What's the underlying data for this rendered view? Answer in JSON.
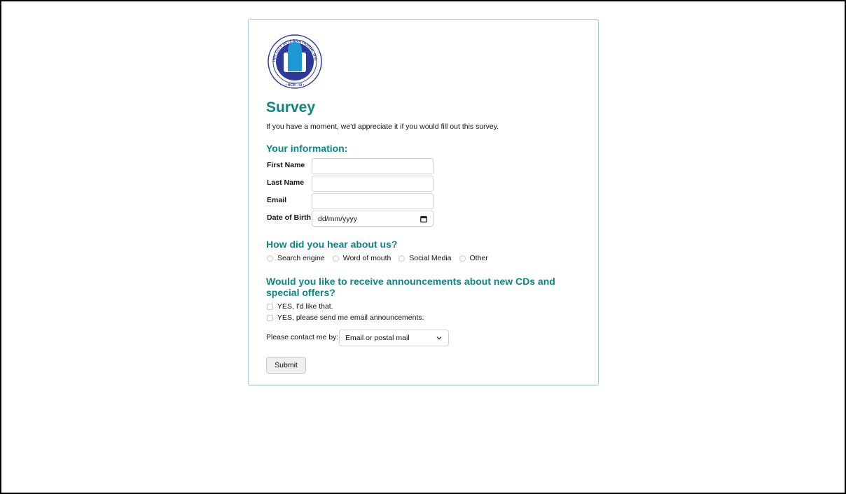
{
  "logo": {
    "ring_text_top": "HOCHIMINH CITY INTERNATIONAL UNIVERSITY",
    "ring_text_bottom": "• HCM - IU •",
    "colors": {
      "navy": "#2b3a9c",
      "cyan": "#1e98d6"
    }
  },
  "survey": {
    "title": "Survey",
    "intro": "If you have a moment, we'd appreciate it if you would fill out this survey."
  },
  "info": {
    "heading": "Your information:",
    "first_name_label": "First Name",
    "first_name_value": "",
    "last_name_label": "Last Name",
    "last_name_value": "",
    "email_label": "Email",
    "email_value": "",
    "dob_label": "Date of Birth",
    "dob_placeholder": "dd/mm/yyyy"
  },
  "hear": {
    "heading": "How did you hear about us?",
    "options": [
      "Search engine",
      "Word of mouth",
      "Social Media",
      "Other"
    ]
  },
  "announcements": {
    "heading": "Would you like to receive announcements about new CDs and special offers?",
    "options": [
      "YES, I'd like that.",
      "YES, please send me email announcements."
    ]
  },
  "contact": {
    "label": "Please contact me by:",
    "selected": "Email or postal mail"
  },
  "submit_label": "Submit",
  "colors": {
    "accent": "#0e8585",
    "card_border": "#a9c9dc"
  }
}
